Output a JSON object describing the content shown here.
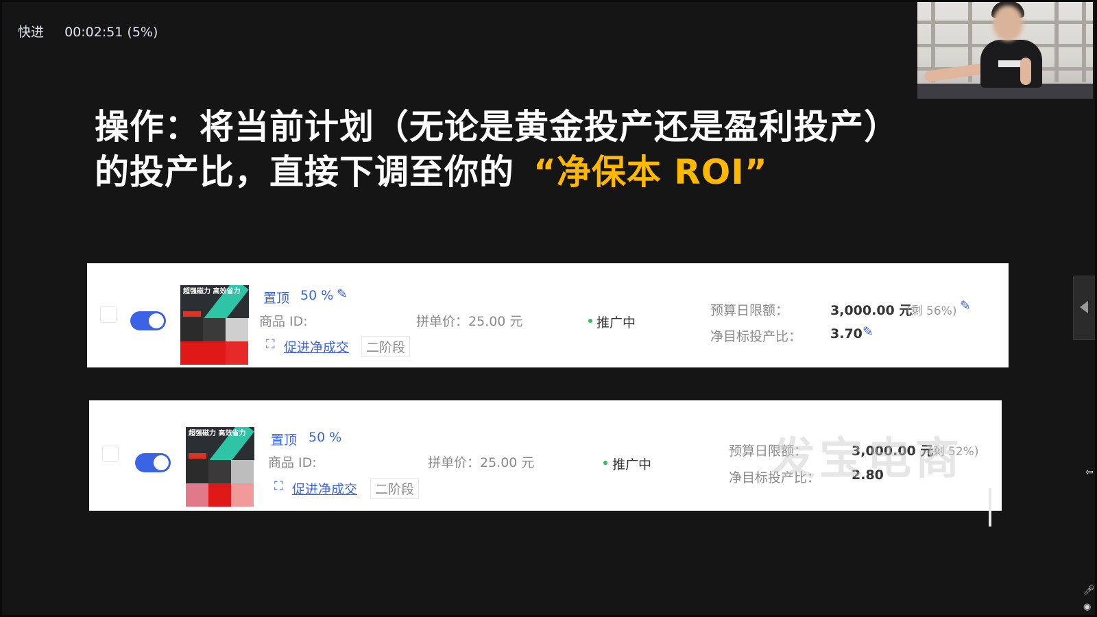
{
  "player": {
    "speed_label": "快进",
    "timestamp": "00:02:51 (5%)"
  },
  "slide": {
    "headline_line1": "操作：将当前计划（无论是黄金投产还是盈利投产）",
    "headline_line2": "的投产比，直接下调至你的",
    "headline_highlight": "“净保本 ROI”",
    "highlight_color": "#ffb800"
  },
  "cards": [
    {
      "thumb_caption": "超强磁力 高效省力",
      "pin_label": "置顶",
      "pin_percent": "50 %",
      "product_id_label": "商品 ID:",
      "group_price": "拼单价：25.00 元",
      "status": "推广中",
      "promo_link": "促进净成交",
      "stage": "二阶段",
      "budget_label": "预算日限额：",
      "budget_value": "3,000.00 元",
      "budget_remaining": "(剩 56%)",
      "roi_label": "净目标投产比：",
      "roi_value": "3.70"
    },
    {
      "thumb_caption": "超强磁力 高效省力",
      "pin_label": "置顶",
      "pin_percent": "50 %",
      "product_id_label": "商品 ID:",
      "group_price": "拼单价：25.00 元",
      "status": "推广中",
      "promo_link": "促进净成交",
      "stage": "二阶段",
      "budget_label": "预算日限额：",
      "budget_value": "3,000.00 元",
      "budget_remaining": "(剩 52%)",
      "roi_label": "净目标投产比：",
      "roi_value": "2.80"
    }
  ],
  "watermark": "发宝电商",
  "colors": {
    "toggle_on": "#3a63e6",
    "link_blue": "#3a63e6",
    "status_green": "#2fbf5b"
  }
}
